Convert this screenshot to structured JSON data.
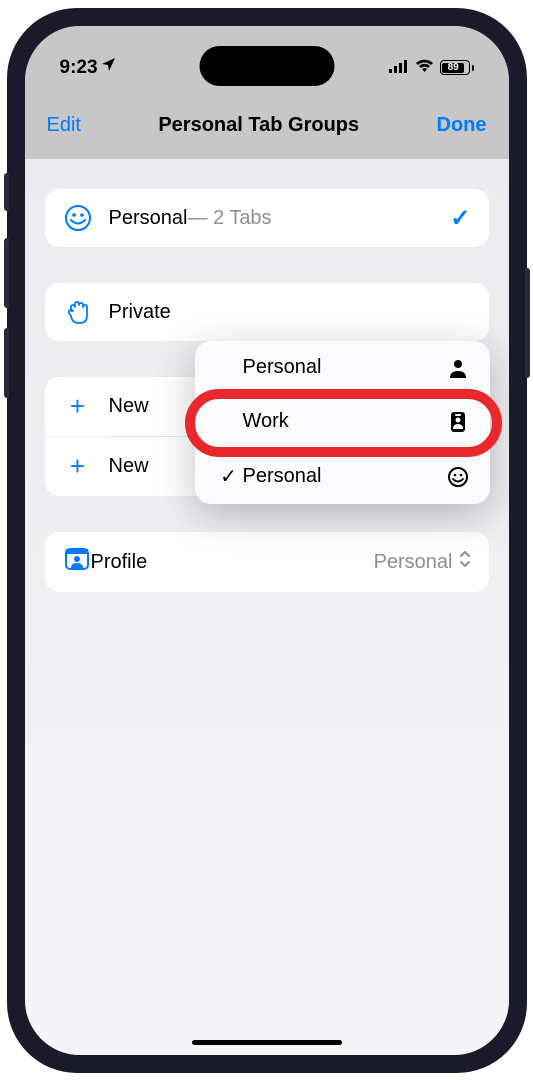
{
  "status": {
    "time": "9:23",
    "battery": "89"
  },
  "header": {
    "left": "Edit",
    "title": "Personal Tab Groups",
    "right": "Done"
  },
  "rows": {
    "personal": {
      "label": "Personal",
      "sublabel": " — 2 Tabs"
    },
    "private": {
      "label": "Private"
    },
    "new1": {
      "label": "New"
    },
    "new2": {
      "label": "New"
    },
    "profile": {
      "label": "Profile",
      "value": "Personal"
    }
  },
  "popover": {
    "items": [
      {
        "label": "Personal",
        "checked": false
      },
      {
        "label": "Work",
        "checked": false
      },
      {
        "label": "Personal",
        "checked": true
      }
    ]
  }
}
